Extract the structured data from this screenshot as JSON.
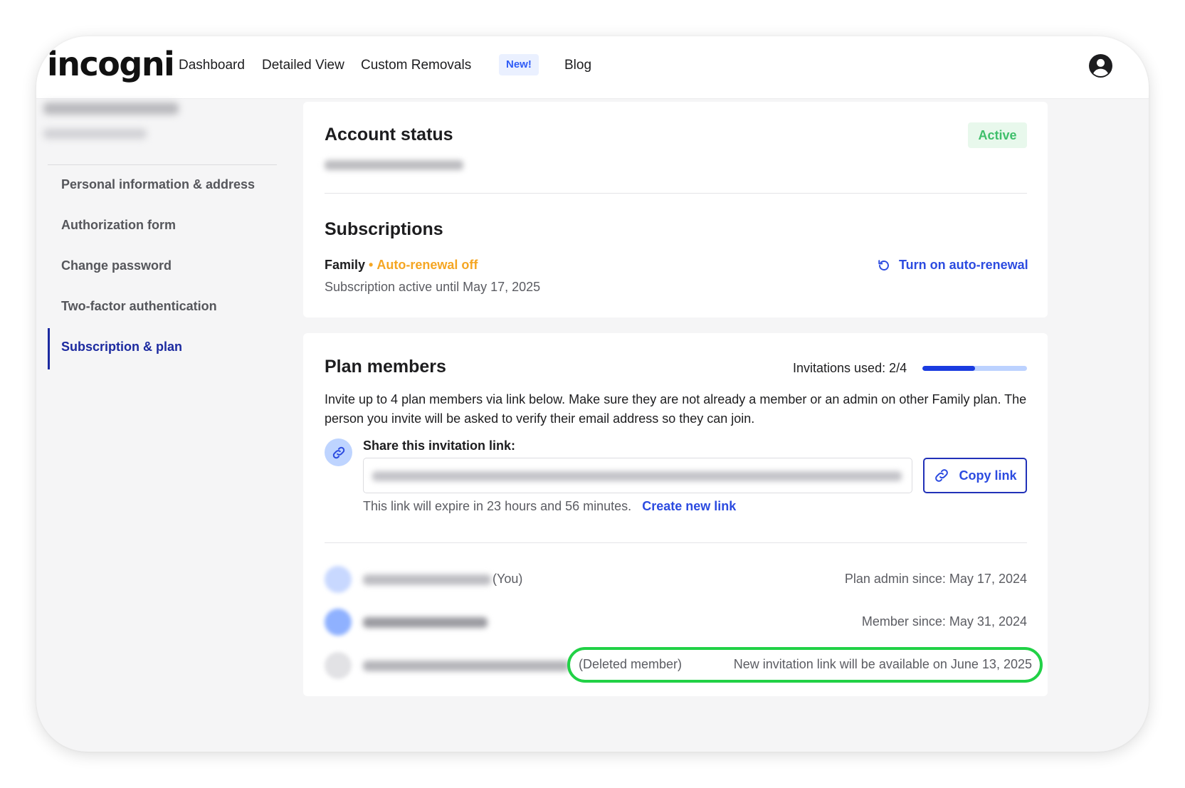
{
  "brand": {
    "logo": "incogni"
  },
  "nav": {
    "items": [
      "Dashboard",
      "Detailed View",
      "Custom Removals",
      "Blog"
    ],
    "new_badge": "New!"
  },
  "sidebar": {
    "items": [
      "Personal information & address",
      "Authorization form",
      "Change password",
      "Two-factor authentication",
      "Subscription & plan"
    ],
    "active_index": 4
  },
  "account_status": {
    "title": "Account status",
    "badge": "Active"
  },
  "subscriptions": {
    "title": "Subscriptions",
    "plan": "Family",
    "separator": "•",
    "renewal_status": "Auto-renewal off",
    "active_until": "Subscription active until May 17, 2025",
    "renew_action": "Turn on auto-renewal"
  },
  "plan_members": {
    "title": "Plan members",
    "invitations_label": "Invitations used: 2/4",
    "invitations_used": 2,
    "invitations_total": 4,
    "description": "Invite up to 4 plan members via link below. Make sure they are not already a member or an admin on other Family plan. The person you invite will be asked to verify their email address so they can join.",
    "share_label": "Share this invitation link:",
    "copy_button": "Copy link",
    "expiry_text": "This link will expire in 23 hours and 56 minutes.",
    "create_new_link": "Create new link",
    "members": [
      {
        "suffix": "(You)",
        "since": "Plan admin since: May 17, 2024"
      },
      {
        "suffix": "",
        "since": "Member since: May 31, 2024"
      },
      {
        "status": "(Deleted member)",
        "note": "New invitation link will be available on June 13, 2025"
      }
    ]
  },
  "colors": {
    "accent_blue": "#2c4be0",
    "active_nav": "#1c2aa0",
    "active_green": "#3fbf6b",
    "warning_orange": "#f5a623",
    "highlight_green": "#21d146"
  }
}
